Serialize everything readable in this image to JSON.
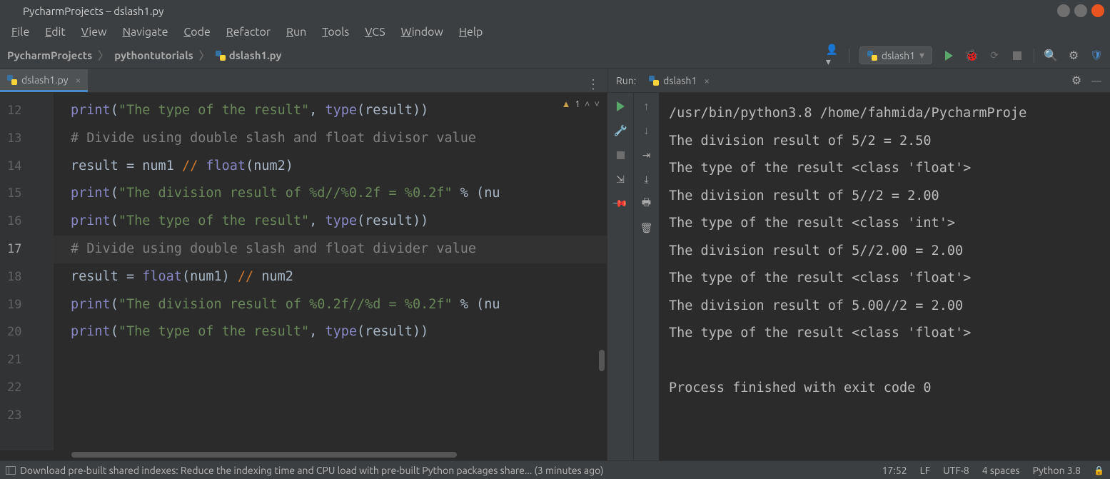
{
  "titlebar": {
    "title": "PycharmProjects – dslash1.py"
  },
  "menubar": [
    "File",
    "Edit",
    "View",
    "Navigate",
    "Code",
    "Refactor",
    "Run",
    "Tools",
    "VCS",
    "Window",
    "Help"
  ],
  "breadcrumb": [
    "PycharmProjects",
    "pythontutorials",
    "dslash1.py"
  ],
  "runConfig": {
    "name": "dslash1"
  },
  "editor": {
    "tab": {
      "name": "dslash1.py"
    },
    "currentLine": 17,
    "warning": {
      "count": "1"
    },
    "lines": [
      {
        "n": 12,
        "tokens": [
          [
            "k-builtin",
            "print"
          ],
          [
            "k-default",
            "("
          ],
          [
            "k-str",
            "\"The type of the result\""
          ],
          [
            "k-default",
            ", "
          ],
          [
            "k-builtin",
            "type"
          ],
          [
            "k-default",
            "(result))"
          ]
        ]
      },
      {
        "n": 13,
        "tokens": [
          [
            "k-comment",
            "# Divide using double slash and float divisor value"
          ]
        ]
      },
      {
        "n": 14,
        "tokens": [
          [
            "k-default",
            "result = num1 "
          ],
          [
            "k-op",
            "//"
          ],
          [
            "k-default",
            " "
          ],
          [
            "k-builtin",
            "float"
          ],
          [
            "k-default",
            "(num2)"
          ]
        ]
      },
      {
        "n": 15,
        "tokens": [
          [
            "k-builtin",
            "print"
          ],
          [
            "k-default",
            "("
          ],
          [
            "k-str",
            "\"The division result of %d//%0.2f = %0.2f\""
          ],
          [
            "k-default",
            " % (nu"
          ]
        ]
      },
      {
        "n": 16,
        "tokens": [
          [
            "k-builtin",
            "print"
          ],
          [
            "k-default",
            "("
          ],
          [
            "k-str",
            "\"The type of the result\""
          ],
          [
            "k-default",
            ", "
          ],
          [
            "k-builtin",
            "type"
          ],
          [
            "k-default",
            "(result))"
          ]
        ]
      },
      {
        "n": 17,
        "tokens": [
          [
            "k-comment",
            "# Divide using double slash and float divider value"
          ]
        ]
      },
      {
        "n": 18,
        "tokens": [
          [
            "k-default",
            "result = "
          ],
          [
            "k-builtin",
            "float"
          ],
          [
            "k-default",
            "(num1) "
          ],
          [
            "k-op",
            "//"
          ],
          [
            "k-default",
            " num2"
          ]
        ]
      },
      {
        "n": 19,
        "tokens": [
          [
            "k-builtin",
            "print"
          ],
          [
            "k-default",
            "("
          ],
          [
            "k-str",
            "\"The division result of %0.2f//%d = %0.2f\""
          ],
          [
            "k-default",
            " % (nu"
          ]
        ]
      },
      {
        "n": 20,
        "tokens": [
          [
            "k-builtin",
            "print"
          ],
          [
            "k-default",
            "("
          ],
          [
            "k-str",
            "\"The type of the result\""
          ],
          [
            "k-default",
            ", "
          ],
          [
            "k-builtin",
            "type"
          ],
          [
            "k-default",
            "(result))"
          ]
        ]
      },
      {
        "n": 21,
        "tokens": []
      },
      {
        "n": 22,
        "tokens": []
      },
      {
        "n": 23,
        "tokens": []
      }
    ]
  },
  "run": {
    "label": "Run:",
    "tab": "dslash1",
    "output": [
      "/usr/bin/python3.8 /home/fahmida/PycharmProje",
      "The division result of 5/2 = 2.50",
      "The type of the result <class 'float'>",
      "The division result of 5//2 = 2.00",
      "The type of the result <class 'int'>",
      "The division result of 5//2.00 = 2.00",
      "The type of the result <class 'float'>",
      "The division result of 5.00//2 = 2.00",
      "The type of the result <class 'float'>",
      "",
      "Process finished with exit code 0"
    ]
  },
  "statusbar": {
    "message": "Download pre-built shared indexes: Reduce the indexing time and CPU load with pre-built Python packages share... (3 minutes ago)",
    "time": "17:52",
    "lineEnding": "LF",
    "encoding": "UTF-8",
    "indent": "4 spaces",
    "interpreter": "Python 3.8"
  }
}
